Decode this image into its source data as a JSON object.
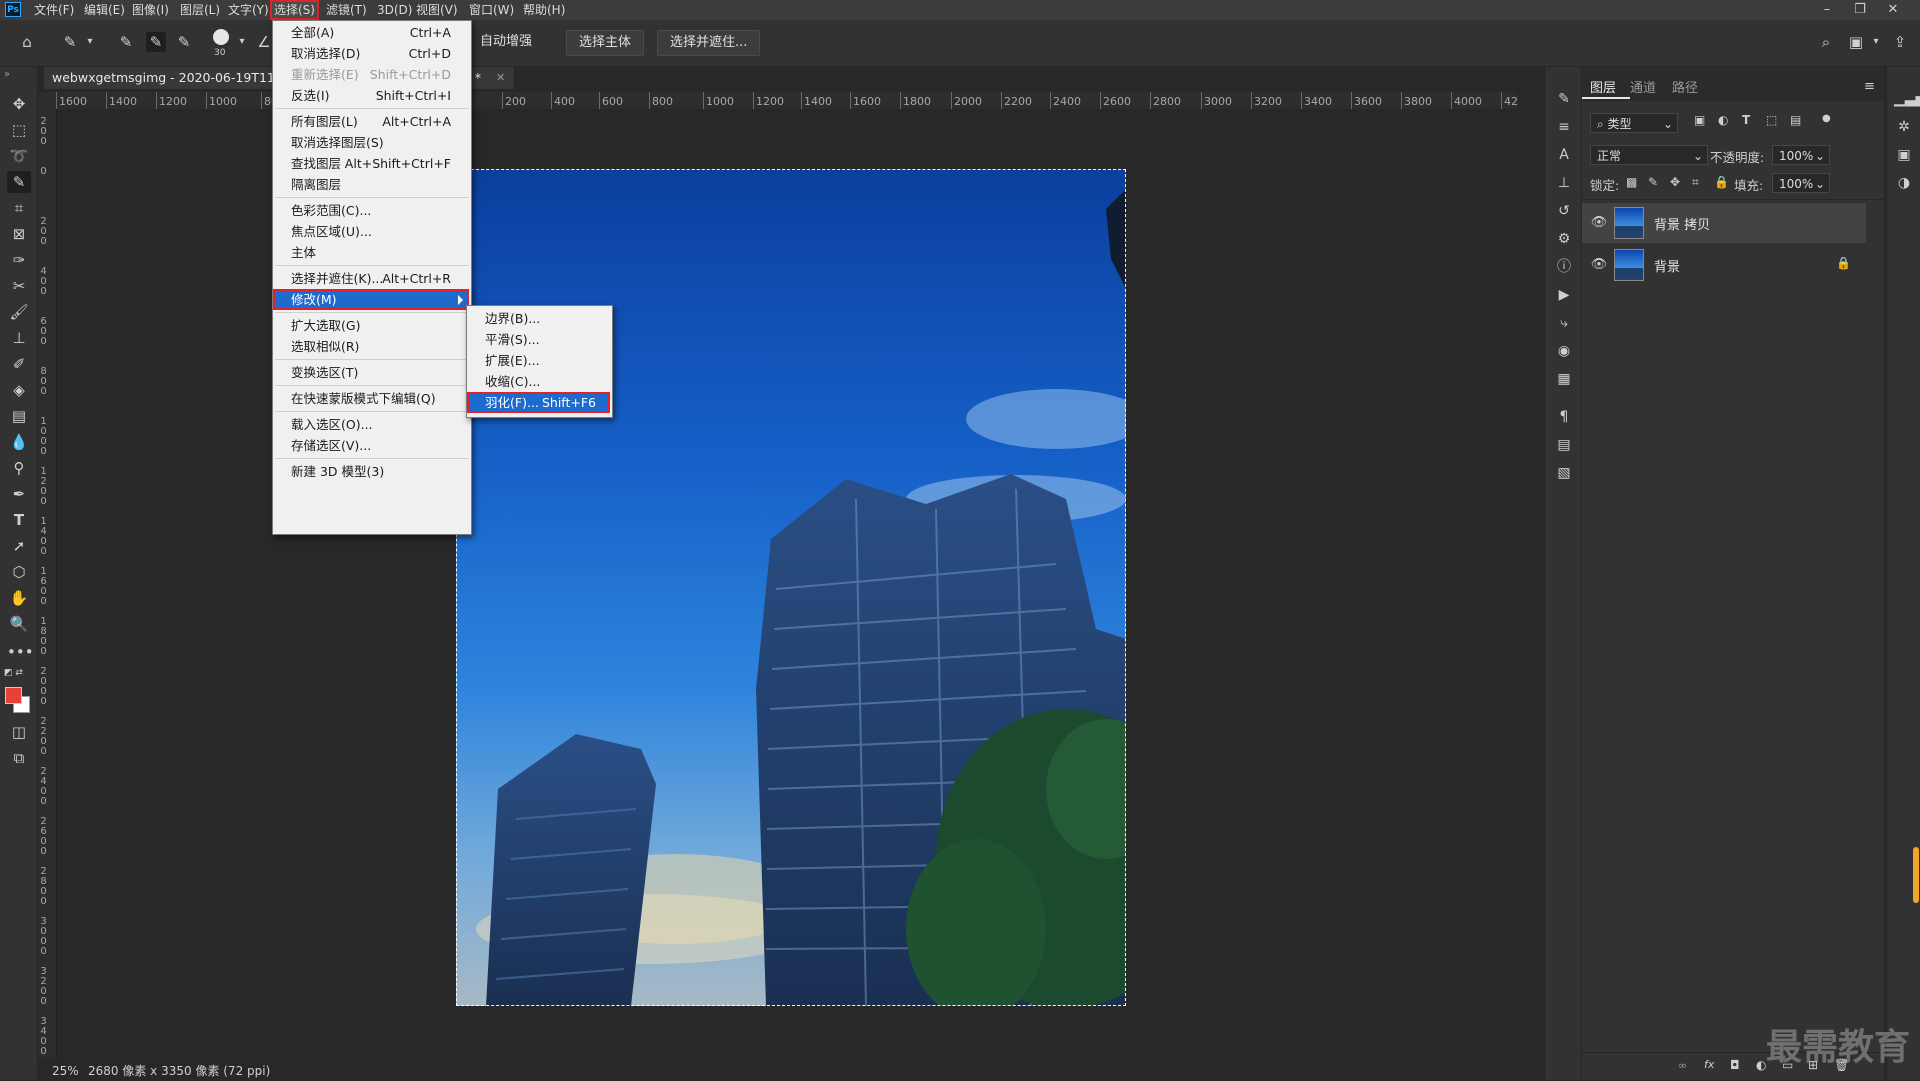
{
  "app": {
    "logo": "Ps",
    "menus": [
      "文件(F)",
      "编辑(E)",
      "图像(I)",
      "图层(L)",
      "文字(Y)",
      "选择(S)",
      "滤镜(T)",
      "3D(D)",
      "视图(V)",
      "窗口(W)",
      "帮助(H)"
    ],
    "active_menu": "选择(S)",
    "window_controls": [
      "minimize-icon",
      "restore-icon",
      "close-icon"
    ]
  },
  "options_bar": {
    "brush_size": "30",
    "auto_enhance_label": "自动增强",
    "select_subject_label": "选择主体",
    "select_and_mask_label": "选择并遮住..."
  },
  "document": {
    "tab_title": "webwxgetmsgimg - 2020-06-19T11193",
    "tab_suffix": "8) *",
    "ruler_h": [
      "1600",
      "1400",
      "1200",
      "1000",
      "80",
      "200",
      "400",
      "600",
      "800",
      "1000",
      "1200",
      "1400",
      "1600",
      "1800",
      "2000",
      "2200",
      "2400",
      "2600",
      "2800",
      "3000",
      "3200",
      "3400",
      "3600",
      "3800",
      "4000",
      "42"
    ],
    "ruler_v": [
      "200",
      "0",
      "200",
      "400",
      "600",
      "800",
      "1000",
      "1200",
      "1400",
      "1600",
      "1800",
      "2000",
      "2200",
      "2400",
      "2600",
      "2800",
      "3000",
      "3200",
      "3400"
    ],
    "zoom": "25%",
    "size_info": "2680 像素 x 3350 像素 (72 ppi)"
  },
  "select_menu": {
    "groups": [
      [
        {
          "label": "全部(A)",
          "shortcut": "Ctrl+A",
          "disabled": false
        },
        {
          "label": "取消选择(D)",
          "shortcut": "Ctrl+D",
          "disabled": false
        },
        {
          "label": "重新选择(E)",
          "shortcut": "Shift+Ctrl+D",
          "disabled": true
        },
        {
          "label": "反选(I)",
          "shortcut": "Shift+Ctrl+I",
          "disabled": false
        }
      ],
      [
        {
          "label": "所有图层(L)",
          "shortcut": "Alt+Ctrl+A",
          "disabled": false
        },
        {
          "label": "取消选择图层(S)",
          "shortcut": "",
          "disabled": false
        },
        {
          "label": "查找图层",
          "shortcut": "Alt+Shift+Ctrl+F",
          "disabled": false
        },
        {
          "label": "隔离图层",
          "shortcut": "",
          "disabled": false
        }
      ],
      [
        {
          "label": "色彩范围(C)...",
          "shortcut": "",
          "disabled": false
        },
        {
          "label": "焦点区域(U)...",
          "shortcut": "",
          "disabled": false
        },
        {
          "label": "主体",
          "shortcut": "",
          "disabled": false
        }
      ],
      [
        {
          "label": "选择并遮住(K)...",
          "shortcut": "Alt+Ctrl+R",
          "disabled": false
        },
        {
          "label": "修改(M)",
          "shortcut": "",
          "disabled": false,
          "submenu": true,
          "highlighted": true
        }
      ],
      [
        {
          "label": "扩大选取(G)",
          "shortcut": "",
          "disabled": false
        },
        {
          "label": "选取相似(R)",
          "shortcut": "",
          "disabled": false
        }
      ],
      [
        {
          "label": "变换选区(T)",
          "shortcut": "",
          "disabled": false
        }
      ],
      [
        {
          "label": "在快速蒙版模式下编辑(Q)",
          "shortcut": "",
          "disabled": false
        }
      ],
      [
        {
          "label": "载入选区(O)...",
          "shortcut": "",
          "disabled": false
        },
        {
          "label": "存储选区(V)...",
          "shortcut": "",
          "disabled": false
        }
      ],
      [
        {
          "label": "新建 3D 模型(3)",
          "shortcut": "",
          "disabled": false
        }
      ]
    ]
  },
  "modify_submenu": [
    {
      "label": "边界(B)...",
      "shortcut": ""
    },
    {
      "label": "平滑(S)...",
      "shortcut": ""
    },
    {
      "label": "扩展(E)...",
      "shortcut": ""
    },
    {
      "label": "收缩(C)...",
      "shortcut": ""
    },
    {
      "label": "羽化(F)...",
      "shortcut": "Shift+F6",
      "highlighted": true
    }
  ],
  "layers_panel": {
    "tabs": [
      "图层",
      "通道",
      "路径"
    ],
    "filter_kind": "类型",
    "blend_mode": "正常",
    "opacity_label": "不透明度:",
    "opacity_value": "100%",
    "lock_label": "锁定:",
    "fill_label": "填充:",
    "fill_value": "100%",
    "layers": [
      {
        "name": "背景 拷贝",
        "selected": true,
        "locked": false
      },
      {
        "name": "背景",
        "selected": false,
        "locked": true
      }
    ]
  },
  "watermark": "最需教育",
  "colors": {
    "accent_highlight": "#1e6bd0",
    "annotation_red": "#e0232b",
    "foreground_swatch": "#e8413a",
    "background_swatch": "#ffffff"
  }
}
